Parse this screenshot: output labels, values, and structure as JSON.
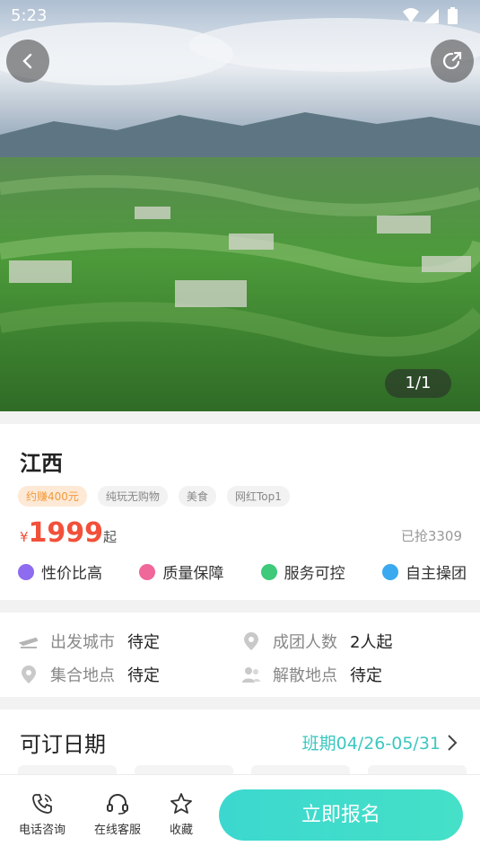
{
  "status_bar": {
    "time": "5:23"
  },
  "gallery": {
    "counter": "1/1"
  },
  "product": {
    "title": "江西",
    "tags": [
      "约赚400元",
      "纯玩无购物",
      "美食",
      "网红Top1"
    ],
    "price": {
      "currency": "¥",
      "amount": "1999",
      "suffix": "起"
    },
    "sold": "已抢3309",
    "features": [
      "性价比高",
      "质量保障",
      "服务可控",
      "自主操团"
    ]
  },
  "meta": {
    "departure": {
      "label": "出发城市",
      "value": "待定"
    },
    "group_size": {
      "label": "成团人数",
      "value": "2人起"
    },
    "meeting_point": {
      "label": "集合地点",
      "value": "待定"
    },
    "dismiss_point": {
      "label": "解散地点",
      "value": "待定"
    }
  },
  "dates": {
    "title": "可订日期",
    "range": "班期04/26-05/31"
  },
  "bottom_bar": {
    "phone": "电话咨询",
    "service": "在线客服",
    "favorite": "收藏",
    "cta": "立即报名"
  },
  "colors": {
    "accent": "#3cc7c0",
    "price": "#f2503a",
    "cta_start": "#3cd8cf",
    "cta_end": "#45e0c7"
  }
}
